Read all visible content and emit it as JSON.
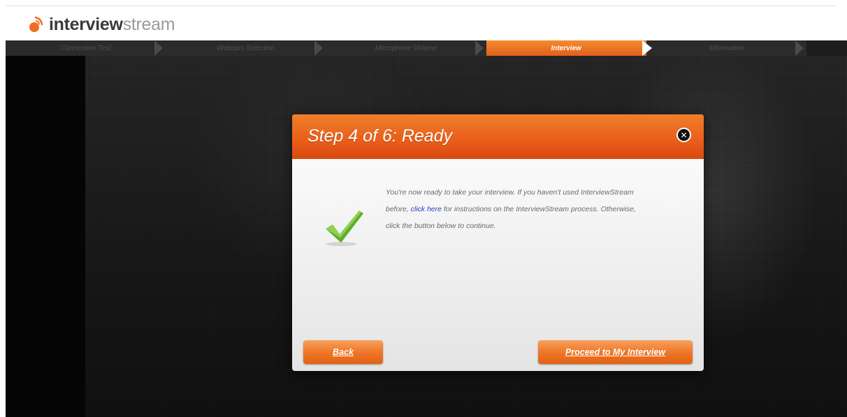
{
  "brand": {
    "name_bold": "interview",
    "name_light": "stream",
    "accent_color": "#ed6e22"
  },
  "steps": [
    {
      "label": "Connection Test",
      "active": false
    },
    {
      "label": "Webcam Selection",
      "active": false
    },
    {
      "label": "Microphone Volume",
      "active": false
    },
    {
      "label": "Interview",
      "active": true
    },
    {
      "label": "Information",
      "active": false
    }
  ],
  "modal": {
    "title": "Step 4 of 6: Ready",
    "close_icon": "close-icon",
    "status_icon": "checkmark-icon",
    "body_before_link": "You're now ready to take your interview. If you haven't used InterviewStream before, ",
    "link_text": "click here",
    "body_after_link": " for instructions on the InterviewStream process. Otherwise, click the button below to continue.",
    "back_label": "Back",
    "proceed_label": "Proceed to My Interview"
  }
}
